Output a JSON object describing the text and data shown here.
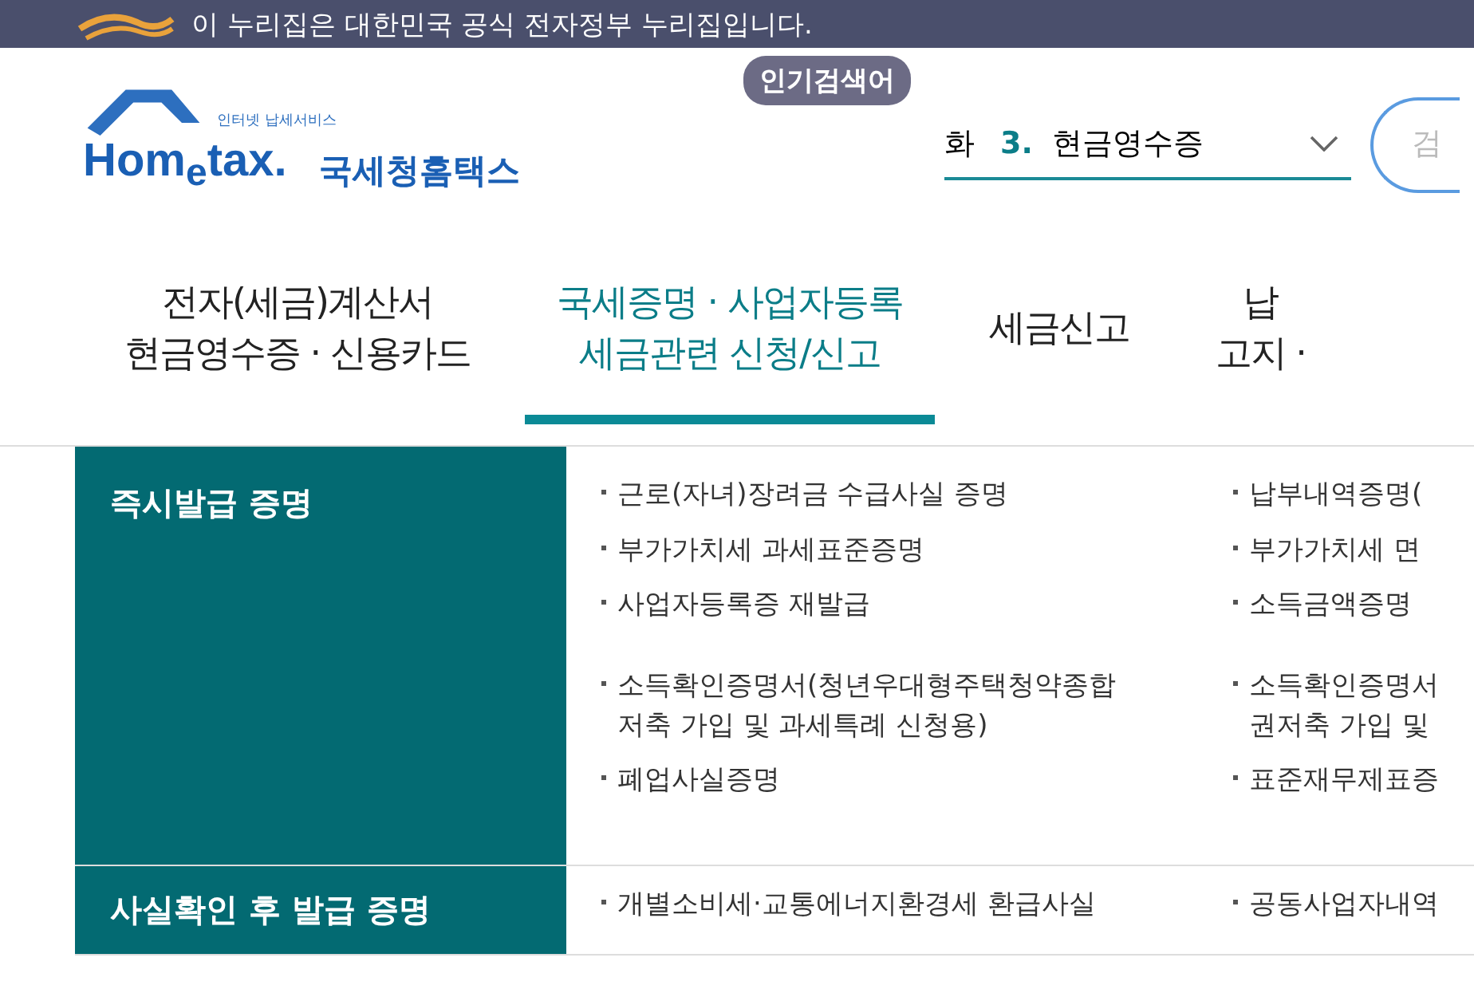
{
  "banner": {
    "text": "이 누리집은 대한민국 공식 전자정부 누리집입니다."
  },
  "logo": {
    "tagline": "인터넷 납세서비스",
    "wordmark": "Hom$_{e}$tax.",
    "name": "국세청홈택스"
  },
  "popular": {
    "badge": "인기검색어",
    "prev": "화",
    "rank": "3.",
    "keyword": "현금영수증"
  },
  "search": {
    "placeholder": "검"
  },
  "nav": [
    {
      "lines": [
        "전자(세금)계산서",
        "현금영수증 · 신용카드"
      ],
      "selected": false
    },
    {
      "lines": [
        "국세증명 · 사업자등록",
        "세금관련 신청/신고"
      ],
      "selected": true
    },
    {
      "lines": [
        "세금신고"
      ],
      "selected": false
    },
    {
      "lines": [
        "납",
        "고지 ·"
      ],
      "selected": false
    }
  ],
  "sections": [
    {
      "title": "즉시발급 증명",
      "rows": [
        [
          {
            "lines": [
              "근로(자녀)장려금 수급사실 증명"
            ]
          },
          {
            "lines": [
              "납부내역증명("
            ]
          }
        ],
        [
          {
            "lines": [
              "부가가치세 과세표준증명"
            ]
          },
          {
            "lines": [
              "부가가치세 면"
            ]
          }
        ],
        [
          {
            "lines": [
              "사업자등록증 재발급"
            ]
          },
          {
            "lines": [
              "소득금액증명"
            ]
          }
        ],
        [
          {
            "lines": [
              "소득확인증명서(청년우대형주택청약종합",
              "저축 가입 및 과세특례 신청용)"
            ]
          },
          {
            "lines": [
              "소득확인증명서",
              "권저축 가입 및"
            ]
          }
        ],
        [
          {
            "lines": [
              "폐업사실증명"
            ]
          },
          {
            "lines": [
              "표준재무제표증"
            ]
          }
        ]
      ]
    },
    {
      "title": "사실확인 후 발급 증명",
      "rows": [
        [
          {
            "lines": [
              "개별소비세·교통에너지환경세 환급사실"
            ]
          },
          {
            "lines": [
              "공동사업자내역"
            ]
          }
        ]
      ]
    }
  ]
}
